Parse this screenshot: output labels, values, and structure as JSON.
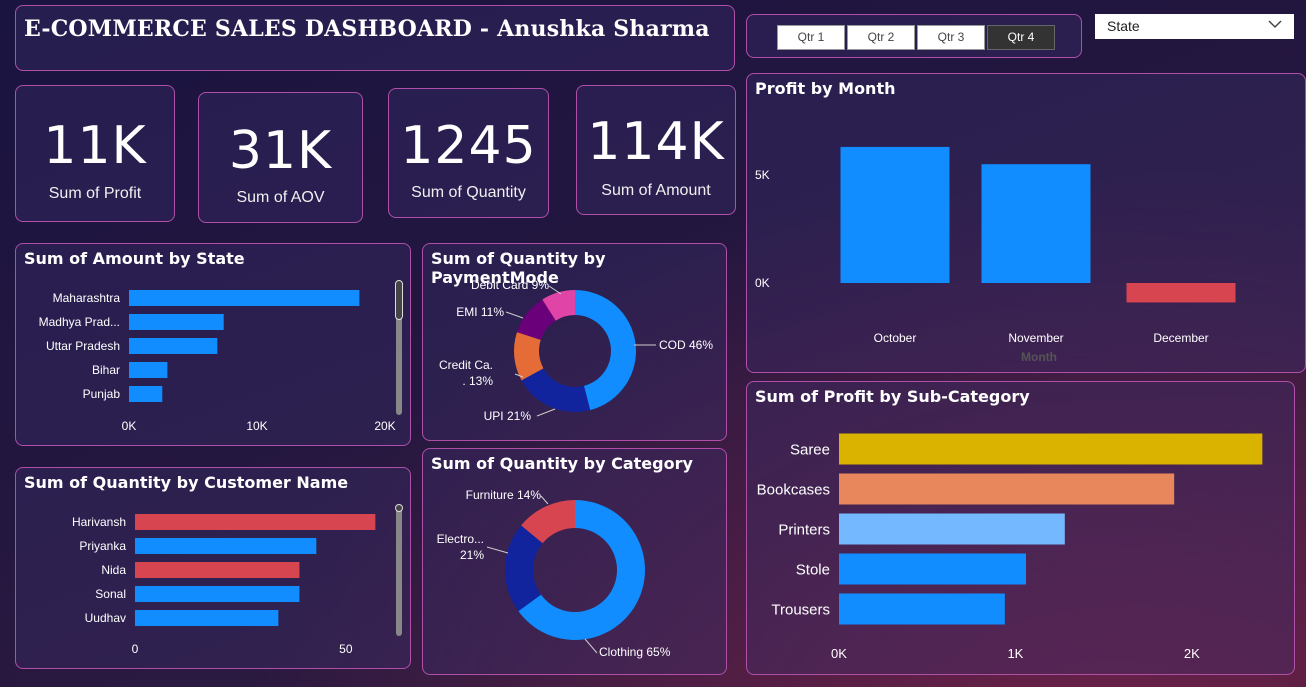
{
  "header": {
    "title": "E-COMMERCE SALES DASHBOARD - Anushka Sharma"
  },
  "quarter_slicer": {
    "options": [
      "Qtr 1",
      "Qtr 2",
      "Qtr 3",
      "Qtr 4"
    ],
    "selected": "Qtr 4"
  },
  "state_dropdown": {
    "label": "State",
    "icon": "chevron-down-icon"
  },
  "kpis": [
    {
      "value": "11K",
      "label": "Sum of Profit"
    },
    {
      "value": "31K",
      "label": "Sum of AOV"
    },
    {
      "value": "1245",
      "label": "Sum of Quantity"
    },
    {
      "value": "114K",
      "label": "Sum of Amount"
    }
  ],
  "colors": {
    "blue": "#118DFF",
    "red": "#D64550",
    "navy": "#12239E",
    "orange": "#E66C37",
    "purple": "#6B007B",
    "pink": "#E044A7",
    "gold": "#D9B300",
    "salmon": "#E8865C",
    "lightblue": "#74B9FF"
  },
  "chart_data": [
    {
      "id": "amount_by_state",
      "type": "bar",
      "orientation": "horizontal",
      "title": "Sum of Amount by State",
      "categories": [
        "Maharashtra",
        "Madhya Prad...",
        "Uttar Pradesh",
        "Bihar",
        "Punjab"
      ],
      "values": [
        18000,
        7400,
        6900,
        3000,
        2600
      ],
      "xlim": [
        0,
        20000
      ],
      "xticks": [
        "0K",
        "10K",
        "20K"
      ],
      "xtick_values": [
        0,
        10000,
        20000
      ]
    },
    {
      "id": "quantity_by_payment",
      "type": "pie",
      "donut": true,
      "title": "Sum of Quantity by PaymentMode",
      "labels": [
        "COD 46%",
        "UPI 21%",
        "Credit Ca... 13%",
        "EMI 11%",
        "Debit Card 9%"
      ],
      "values": [
        46,
        21,
        13,
        11,
        9
      ],
      "colors": [
        "#118DFF",
        "#12239E",
        "#E66C37",
        "#6B007B",
        "#E044A7"
      ]
    },
    {
      "id": "quantity_by_category",
      "type": "pie",
      "donut": true,
      "title": "Sum of Quantity by Category",
      "labels": [
        "Clothing 65%",
        "Electro... 21%",
        "Furniture 14%"
      ],
      "values": [
        65,
        21,
        14
      ],
      "colors": [
        "#118DFF",
        "#12239E",
        "#D64550"
      ]
    },
    {
      "id": "quantity_by_customer",
      "type": "bar",
      "orientation": "horizontal",
      "title": "Sum of Quantity by Customer Name",
      "categories": [
        "Harivansh",
        "Priyanka",
        "Nida",
        "Sonal",
        "Uudhav"
      ],
      "values": [
        57,
        43,
        39,
        39,
        34
      ],
      "bar_colors": [
        "#D64550",
        "#118DFF",
        "#D64550",
        "#118DFF",
        "#118DFF"
      ],
      "xlim": [
        0,
        60
      ],
      "xticks": [
        "0",
        "50"
      ],
      "xtick_values": [
        0,
        50
      ]
    },
    {
      "id": "profit_by_month",
      "type": "bar",
      "title": "Profit by Month",
      "categories": [
        "October",
        "November",
        "December"
      ],
      "values": [
        6300,
        5500,
        -900
      ],
      "bar_colors": [
        "#118DFF",
        "#118DFF",
        "#D64550"
      ],
      "xlabel": "Month",
      "ylim": [
        -1500,
        8000
      ],
      "yticks": [
        "0K",
        "5K"
      ],
      "ytick_values": [
        0,
        5000
      ]
    },
    {
      "id": "profit_by_subcategory",
      "type": "bar",
      "orientation": "horizontal",
      "title": "Sum of Profit by Sub-Category",
      "categories": [
        "Saree",
        "Bookcases",
        "Printers",
        "Stole",
        "Trousers"
      ],
      "values": [
        2400,
        1900,
        1280,
        1060,
        940
      ],
      "bar_colors": [
        "#D9B300",
        "#E8865C",
        "#74B9FF",
        "#118DFF",
        "#118DFF"
      ],
      "xlim": [
        0,
        2500
      ],
      "xticks": [
        "0K",
        "1K",
        "2K"
      ],
      "xtick_values": [
        0,
        1000,
        2000
      ]
    }
  ]
}
